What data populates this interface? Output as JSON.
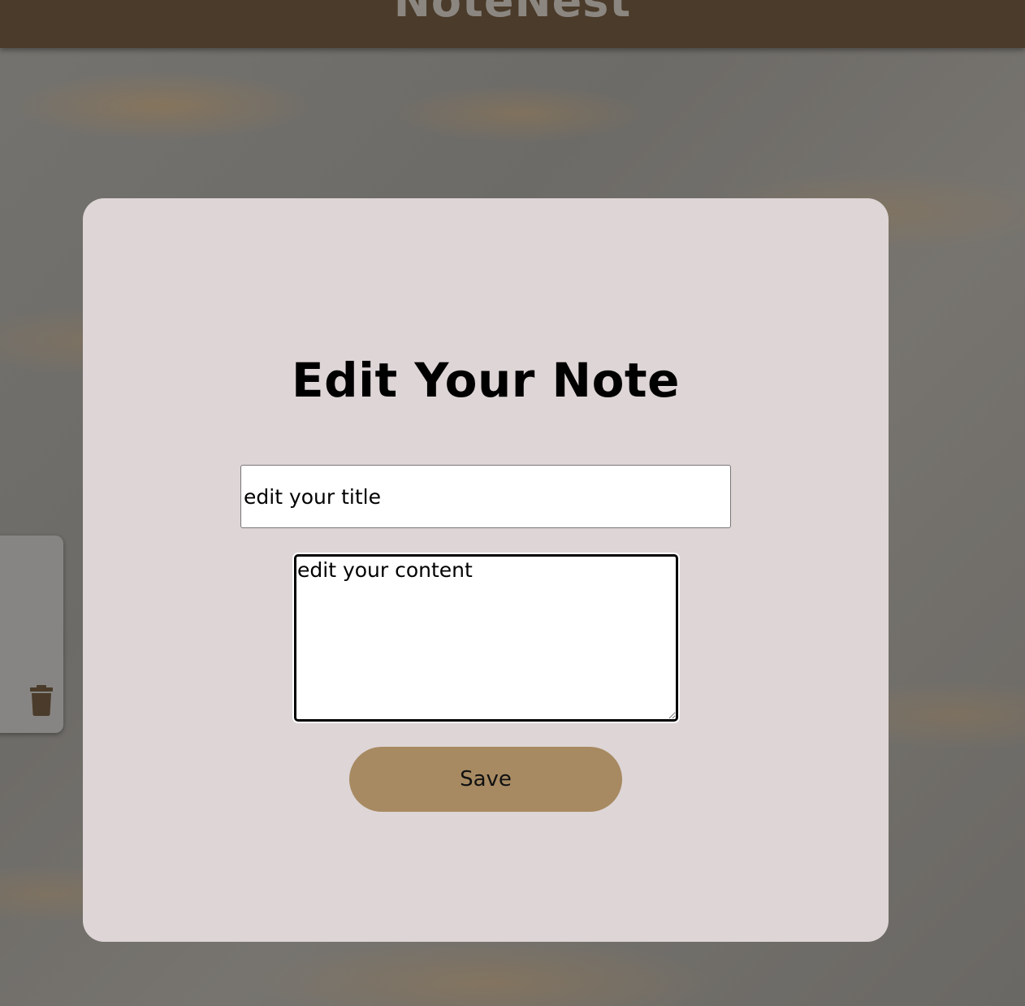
{
  "header": {
    "brand": "NoteNest"
  },
  "sidebar_note": {
    "delete_icon": "trash-icon",
    "icon_color": "#4a3b2a"
  },
  "modal": {
    "title": "Edit Your Note",
    "title_input_value": "edit your title",
    "content_value": "edit your content",
    "save_label": "Save"
  },
  "colors": {
    "header_bg": "#4a3b2a",
    "modal_bg": "#ded5d6",
    "accent": "#a78a62"
  }
}
